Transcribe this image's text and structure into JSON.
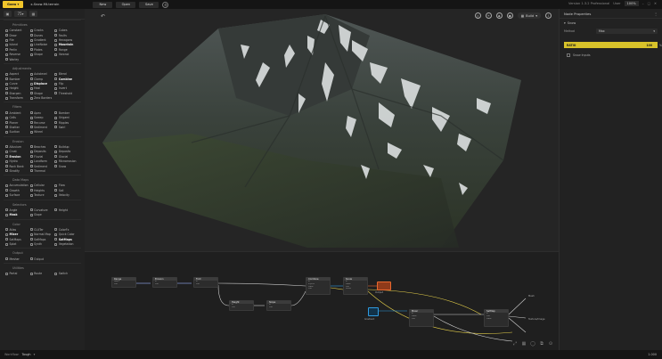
{
  "app": {
    "logo": "Gaea",
    "file_name": "x-Snow-Mt.terrain",
    "menus": [
      "New",
      "Open",
      "Save"
    ],
    "version_text": "Version 1.3.2 Professional",
    "user_label": "User",
    "zoom": "100%"
  },
  "library": {
    "tool_value": "75",
    "categories": [
      {
        "title": "Primitives",
        "items": [
          {
            "label": "Constant"
          },
          {
            "label": "Cracks"
          },
          {
            "label": "Cubes"
          },
          {
            "label": "Draw"
          },
          {
            "label": "Dunes"
          },
          {
            "label": "Faults"
          },
          {
            "label": "File"
          },
          {
            "label": "Gradient"
          },
          {
            "label": "Hexagons"
          },
          {
            "label": "Island"
          },
          {
            "label": "LineNoise"
          },
          {
            "label": "Mountain",
            "bold": true
          },
          {
            "label": "Perlin"
          },
          {
            "label": "Plates"
          },
          {
            "label": "Range"
          },
          {
            "label": "Reverse"
          },
          {
            "label": "Shape"
          },
          {
            "label": "Voronoi"
          },
          {
            "label": "Worley"
          }
        ]
      },
      {
        "title": "Adjustments",
        "items": [
          {
            "label": "Aspect"
          },
          {
            "label": "Autolevel"
          },
          {
            "label": "Blend"
          },
          {
            "label": "Bomber"
          },
          {
            "label": "Clamp"
          },
          {
            "label": "Combine",
            "bold": true
          },
          {
            "label": "Curve"
          },
          {
            "label": "Displace",
            "bold": true
          },
          {
            "label": "Flip"
          },
          {
            "label": "Height"
          },
          {
            "label": "Heal"
          },
          {
            "label": "Invert"
          },
          {
            "label": "Sharpen"
          },
          {
            "label": "Shape"
          },
          {
            "label": "Threshold"
          },
          {
            "label": "Transform"
          },
          {
            "label": "Zero Borders"
          }
        ]
      },
      {
        "title": "Filters",
        "items": [
          {
            "label": "Ambient"
          },
          {
            "label": "Apex"
          },
          {
            "label": "Bomber"
          },
          {
            "label": "Cells"
          },
          {
            "label": "Sweep"
          },
          {
            "label": "Origami"
          },
          {
            "label": "Planer"
          },
          {
            "label": "Recurse"
          },
          {
            "label": "Ripples"
          },
          {
            "label": "Shatter"
          },
          {
            "label": "Sediment"
          },
          {
            "label": "Swirl"
          },
          {
            "label": "Suction"
          },
          {
            "label": "Wheel"
          }
        ]
      },
      {
        "title": "Erosion",
        "items": [
          {
            "label": "Alluvium"
          },
          {
            "label": "Beaches"
          },
          {
            "label": "Buildup"
          },
          {
            "label": "Crust"
          },
          {
            "label": "Deposits"
          },
          {
            "label": "Deposits"
          },
          {
            "label": "Erosion",
            "bold": true
          },
          {
            "label": "Fluvial"
          },
          {
            "label": "Glacial"
          },
          {
            "label": "Hydro"
          },
          {
            "label": "Landform"
          },
          {
            "label": "Microerosion"
          },
          {
            "label": "Rock Bank"
          },
          {
            "label": "Sediment"
          },
          {
            "label": "Snow"
          },
          {
            "label": "Stratify"
          },
          {
            "label": "Thermal"
          }
        ]
      },
      {
        "title": "Data Maps",
        "items": [
          {
            "label": "Accumulation"
          },
          {
            "label": "Cellular"
          },
          {
            "label": "Flow"
          },
          {
            "label": "Growth"
          },
          {
            "label": "Heights"
          },
          {
            "label": "Soil"
          },
          {
            "label": "Surface"
          },
          {
            "label": "Texture"
          },
          {
            "label": "Velocity"
          }
        ]
      },
      {
        "title": "Selectors",
        "items": [
          {
            "label": "Angle"
          },
          {
            "label": "Curvature"
          },
          {
            "label": "Height"
          },
          {
            "label": "Mask",
            "bold": true
          },
          {
            "label": "Slope"
          }
        ]
      },
      {
        "title": "Color",
        "items": [
          {
            "label": "Atlas"
          },
          {
            "label": "CLUTer"
          },
          {
            "label": "ColorFx"
          },
          {
            "label": "Mixer",
            "bold": true
          },
          {
            "label": "Normal Map"
          },
          {
            "label": "Quick Color"
          },
          {
            "label": "SatMaps"
          },
          {
            "label": "SatMaps"
          },
          {
            "label": "SatMaps",
            "bold": true
          },
          {
            "label": "Splat"
          },
          {
            "label": "Synth"
          },
          {
            "label": "Vegetation"
          }
        ]
      },
      {
        "title": "Output",
        "items": [
          {
            "label": "Mesher"
          },
          {
            "label": "Output"
          }
        ]
      },
      {
        "title": "Utilities",
        "items": [
          {
            "label": "Portal"
          },
          {
            "label": "Route"
          },
          {
            "label": "Switch"
          }
        ]
      }
    ]
  },
  "viewport": {
    "build_label": "Build"
  },
  "graph": {
    "nodes": [
      {
        "id": "range",
        "title": "Range",
        "rows": [
          "Seed",
          "Out"
        ]
      },
      {
        "id": "erosion",
        "title": "Erosion",
        "rows": [
          "In",
          "Out"
        ]
      },
      {
        "id": "fold",
        "title": "Fold",
        "rows": [
          "In",
          "Out"
        ]
      },
      {
        "id": "combine",
        "title": "Combine",
        "rows": [
          "In",
          "Input2",
          "Mask",
          "Out"
        ]
      },
      {
        "id": "snow",
        "title": "Snow",
        "rows": [
          "In",
          "Mask",
          "Out",
          "Snow"
        ]
      },
      {
        "id": "height",
        "title": "Height",
        "rows": [
          "In",
          "Out"
        ]
      },
      {
        "id": "slope",
        "title": "Slope",
        "rows": [
          "In",
          "Out"
        ]
      },
      {
        "id": "out1",
        "title": "Output",
        "rows": []
      },
      {
        "id": "src",
        "title": "Gradient",
        "rows": []
      },
      {
        "id": "mixer",
        "title": "Mixer",
        "rows": [
          "In",
          "Mask",
          "Out"
        ]
      },
      {
        "id": "satmap",
        "title": "SatMap",
        "rows": [
          "In",
          "Out",
          "Mask"
        ]
      }
    ],
    "labels": [
      "Mesh",
      "Texture/Image"
    ]
  },
  "properties": {
    "header": "Node Properties",
    "section": "Snow",
    "method_label": "Method",
    "method_value": "Max",
    "slider_label": "RATIO",
    "slider_value": "100",
    "slider_fraction": 1.0,
    "slider_unit": "%",
    "checkbox_label": "Snow Inputs"
  },
  "status": {
    "label": "Workflow:",
    "value": "Tough",
    "right": "1.000"
  },
  "colors": {
    "accent": "#f2c62b",
    "slider": "#d8c22a",
    "output_node": "#e8682f",
    "input_node": "#2f9be0"
  }
}
